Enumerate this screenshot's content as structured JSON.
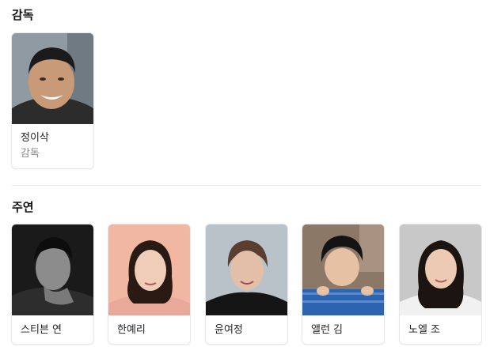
{
  "director_section": {
    "title": "감독",
    "people": [
      {
        "name": "정이삭",
        "role": "감독"
      }
    ]
  },
  "cast_section": {
    "title": "주연",
    "people": [
      {
        "name": "스티븐 연"
      },
      {
        "name": "한예리"
      },
      {
        "name": "윤여정"
      },
      {
        "name": "앨런 김"
      },
      {
        "name": "노엘 조"
      }
    ]
  }
}
